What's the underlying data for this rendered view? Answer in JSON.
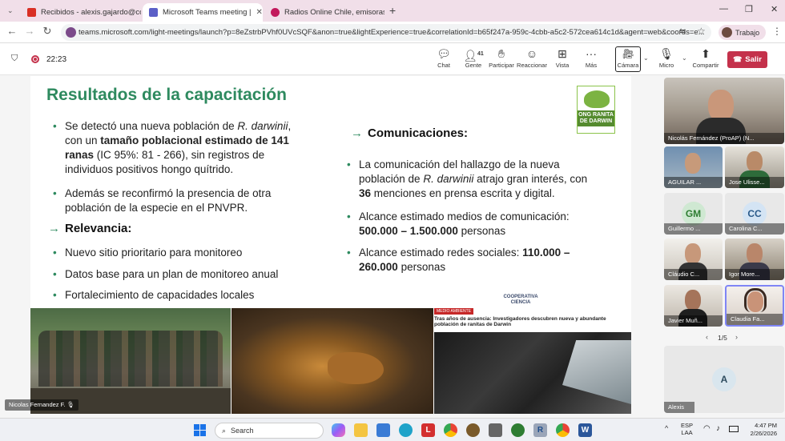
{
  "browser": {
    "tabs": [
      {
        "label": "Recibidos - alexis.gajardo@co",
        "color": "#d93025"
      },
      {
        "label": "Microsoft Teams meeting |",
        "color": "#5b5fc7"
      },
      {
        "label": "Radios Online Chile, emisoras o",
        "color": "#c2185b"
      }
    ],
    "new_tab_symbol": "+",
    "url": "teams.microsoft.com/light-meetings/launch?p=8eZstrbPVhf0UVcSQF&anon=true&lightExperience=true&correlationId=b65f247a-959c-4cbb-a5c2-572cea614c1d&agent=web&coords=e...",
    "profile_label": "Trabajo"
  },
  "meeting": {
    "timer": "22:23",
    "toolbar": {
      "chat": "Chat",
      "people": "Gente",
      "people_count": "41",
      "raise": "Participar",
      "react": "Reaccionar",
      "view": "Vista",
      "more": "Más",
      "camera": "Cámara",
      "mic": "Micro",
      "share": "Compartir",
      "leave": "Salir"
    }
  },
  "slide": {
    "title": "Resultados de la capacitación",
    "logo_text": "ONG RANITA DE DARWIN",
    "left_bullets": {
      "b1_pre": "Se detectó una nueva población de ",
      "b1_italic": "R. darwinii",
      "b1_mid": ", con un ",
      "b1_bold": "tamaño poblacional estimado de 141 ranas",
      "b1_post": " (IC 95%: 81 - 266), sin registros de individuos positivos hongo quítrido.",
      "b2": "Además se reconfirmó la presencia de otra población de la especie en el PNVPR."
    },
    "relevancia_heading": "Relevancia:",
    "relevancia_items": [
      "Nuevo sitio prioritario para monitoreo",
      "Datos base para un plan de monitoreo anual",
      "Fortalecimiento de capacidades locales"
    ],
    "comms_heading": "Comunicaciones:",
    "comms": {
      "c1_pre": "La comunicación del hallazgo de la nueva población de ",
      "c1_italic": "R. darwinii",
      "c1_mid": " atrajo gran interés, con ",
      "c1_bold": "36",
      "c1_post": " menciones en prensa escrita y digital.",
      "c2_pre": "Alcance estimado medios de comunicación: ",
      "c2_bold": "500.000 – 1.500.000",
      "c2_post": " personas",
      "c3_pre": "Alcance estimado redes sociales: ",
      "c3_bold": "110.000 – 260.000",
      "c3_post": " personas"
    },
    "news": {
      "source_logo": "COOPERATIVA CIENCIA",
      "tag": "MEDIO AMBIENTE",
      "headline": "Tras años de ausencia: Investigadores descubren nueva y abundante población de ranitas de Darwin"
    },
    "presenter_label": "Nicolas Fernandez F."
  },
  "participants": {
    "main": "Nicolás Fernández (ProAP) (N...",
    "tiles": [
      {
        "name": "AGUILAR ...",
        "initials": ""
      },
      {
        "name": "Jose Ulisse...",
        "initials": ""
      },
      {
        "name": "Guillermo ...",
        "initials": "GM"
      },
      {
        "name": "Carolina C...",
        "initials": "CC"
      },
      {
        "name": "Cláudio C...",
        "initials": ""
      },
      {
        "name": "Igor More...",
        "initials": ""
      },
      {
        "name": "Javier Muñ...",
        "initials": ""
      },
      {
        "name": "Claudia Fa...",
        "initials": ""
      }
    ],
    "pagination": "1/5",
    "self": {
      "name": "Alexis",
      "initials": "A"
    }
  },
  "taskbar": {
    "search": "Search",
    "lang_top": "ESP",
    "lang_bottom": "LAA",
    "time": "4:47 PM",
    "date": "2/26/2026"
  }
}
